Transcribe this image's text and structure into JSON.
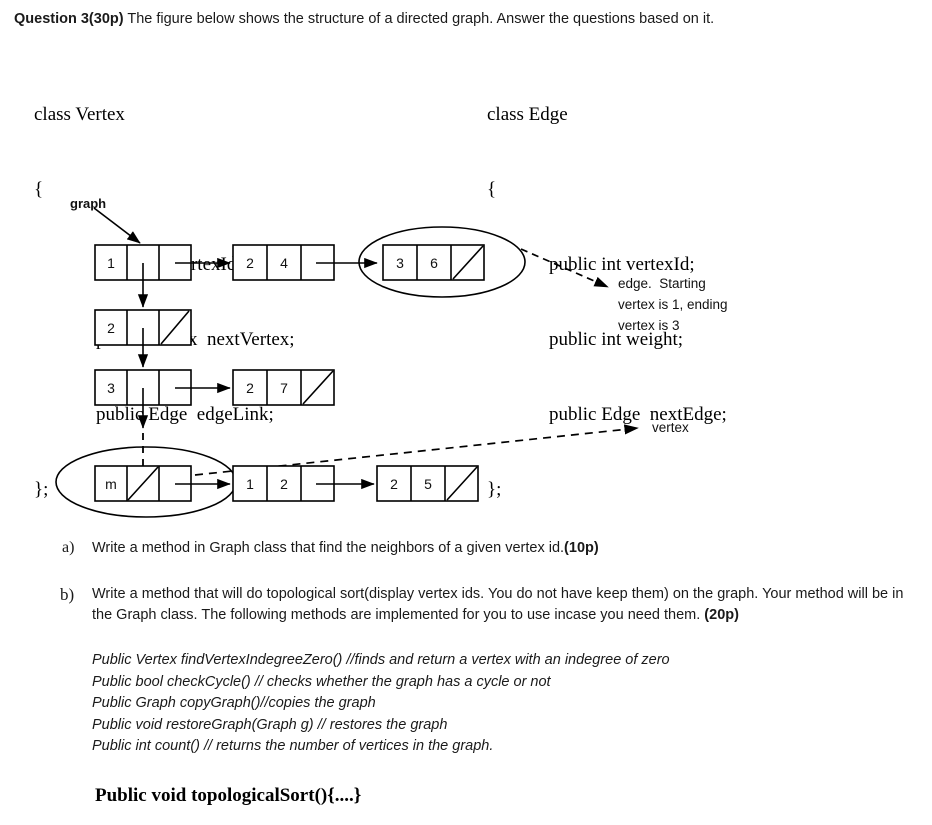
{
  "header": {
    "question_number": "Question 3(30p)",
    "prompt": " The figure below shows the structure of a directed graph. Answer the questions based on it."
  },
  "class_vertex": {
    "name": "class Vertex",
    "open_brace": "{",
    "members": [
      "public int vertexId;",
      "public Vertex  nextVertex;",
      "public Edge  edgeLink;"
    ],
    "close_brace": "};"
  },
  "class_edge": {
    "name": "class Edge",
    "open_brace": "{",
    "members": [
      "public int vertexId;",
      "public int weight;",
      "public Edge  nextEdge;"
    ],
    "close_brace": "};"
  },
  "diagram": {
    "graph_pointer_label": "graph",
    "edge_annotation": "edge.  Starting\nvertex is 1, ending\nvertex is 3",
    "vertex_annotation": "vertex",
    "vertex_nodes": [
      {
        "id": "1",
        "has_next_vertex": true,
        "has_edge_link": true
      },
      {
        "id": "2",
        "has_next_vertex": true,
        "has_edge_link": false
      },
      {
        "id": "3",
        "has_next_vertex": true,
        "has_edge_link": true
      },
      {
        "id": "m",
        "has_next_vertex": false,
        "has_edge_link": true
      }
    ],
    "edge_nodes": [
      {
        "row": 1,
        "vertexId": "2",
        "weight": "4",
        "has_next_edge": true
      },
      {
        "row": 1,
        "vertexId": "3",
        "weight": "6",
        "has_next_edge": false,
        "circled": true
      },
      {
        "row": 3,
        "vertexId": "2",
        "weight": "7",
        "has_next_edge": false
      },
      {
        "row": 4,
        "vertexId": "1",
        "weight": "2",
        "has_next_edge": true
      },
      {
        "row": 4,
        "vertexId": "2",
        "weight": "5",
        "has_next_edge": false
      }
    ]
  },
  "questions": {
    "a": {
      "marker": "a)",
      "text": "Write a method in Graph class that find the neighbors of a given vertex id.",
      "points": "(10p)"
    },
    "b": {
      "marker": "b)",
      "text_1": "Write a method that will do topological sort(display vertex ids. You do not have keep them) on the graph. Your method will be in the Graph class. The following methods are implemented for you to use incase you need them. ",
      "points": "(20p)",
      "methods": [
        "Public Vertex findVertexIndegreeZero() //finds and return a vertex with an indegree of zero",
        "Public bool checkCycle() // checks whether the graph has a cycle or not",
        "Public Graph copyGraph()//copies the graph",
        "Public void restoreGraph(Graph g) // restores the graph",
        "Public int count() // returns the number of vertices in the graph."
      ],
      "signature": "Public void topologicalSort(){....}"
    }
  }
}
